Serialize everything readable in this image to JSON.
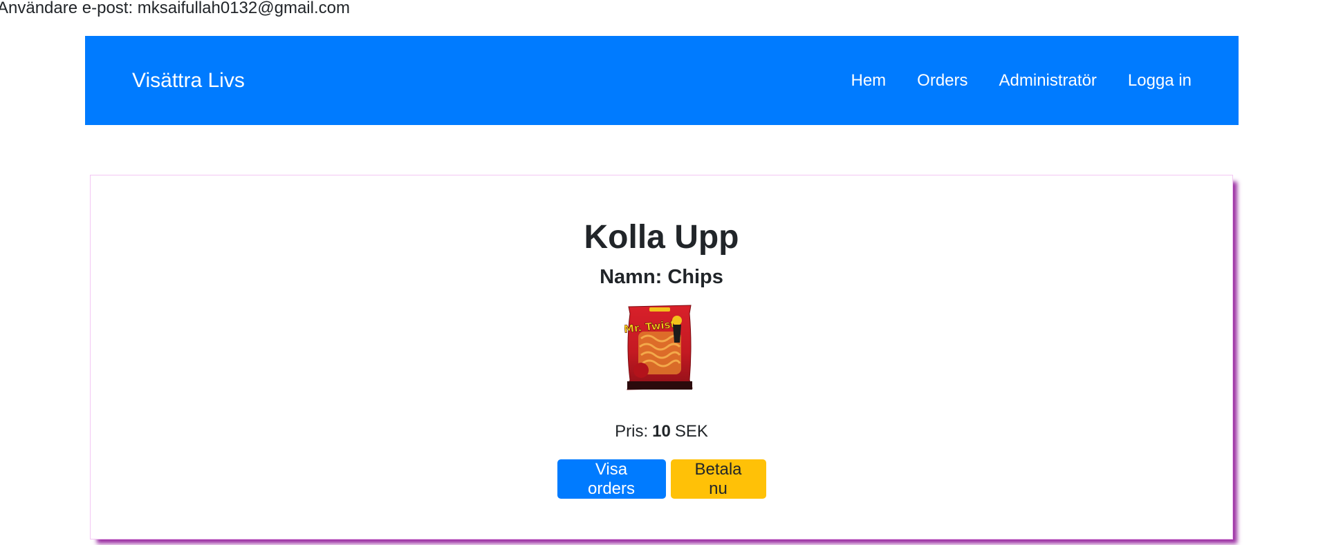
{
  "user": {
    "label": "Användare e-post:",
    "email": "mksaifullah0132@gmail.com"
  },
  "navbar": {
    "brand": "Visättra Livs",
    "links": [
      "Hem",
      "Orders",
      "Administratör",
      "Logga in"
    ],
    "color": "#007bff"
  },
  "checkout": {
    "title": "Kolla Upp",
    "name_label": "Namn:",
    "name_value": "Chips",
    "product_image": {
      "icon": "chips-bag-image",
      "brand_text": "Mr. Twist"
    },
    "price_label": "Pris:",
    "price_value": "10",
    "currency": "SEK",
    "buttons": {
      "view_orders": "Visa orders",
      "pay_now": "Betala nu"
    }
  },
  "colors": {
    "primary": "#007bff",
    "warning": "#ffc107",
    "card_shadow": "#9b30a3"
  }
}
